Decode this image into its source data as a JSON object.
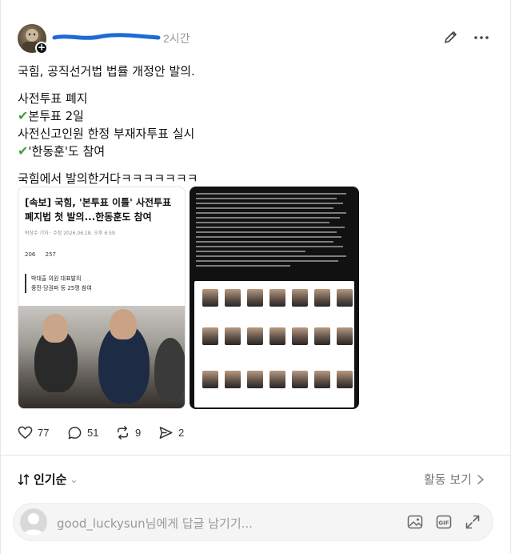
{
  "post": {
    "timestamp": "2시간",
    "lines": [
      "국힘, 공직선거법 법률 개정안 발의.",
      "사전투표 폐지",
      "본투표 2일",
      "사전신고인원 한정 부재자투표 실시",
      "'한동훈'도 참여",
      "국힘에서 발의한거다ㅋㅋㅋㅋㅋㅋㅋ"
    ],
    "icons": {
      "edit": "edit-pencil-icon",
      "more": "more-dots-icon",
      "check": "check-mark-icon"
    }
  },
  "news_card": {
    "headline": "[속보] 국힘, '본투표 이틀' 사전투표 폐지법 첫 발의...한동훈도 참여",
    "byline": "박상수 기자",
    "meta": "수정 2026.06.18. 오후 6:59",
    "likes": "206",
    "comments": "257",
    "quote_line1": "박대출 의원 대표발의",
    "quote_line2": "중진·당권파 등 25명 참여"
  },
  "actions": {
    "like_count": "77",
    "comment_count": "51",
    "repost_count": "9",
    "share_count": "2"
  },
  "comments_section": {
    "sort_label": "인기순",
    "activity_label": "활동 보기"
  },
  "reply": {
    "placeholder": "good_luckysun님에게 답글 남기기...",
    "icons": [
      "image-icon",
      "gif-icon",
      "expand-icon"
    ]
  },
  "colors": {
    "check_green": "#3aa33a",
    "text": "#111111",
    "muted": "#999999"
  }
}
